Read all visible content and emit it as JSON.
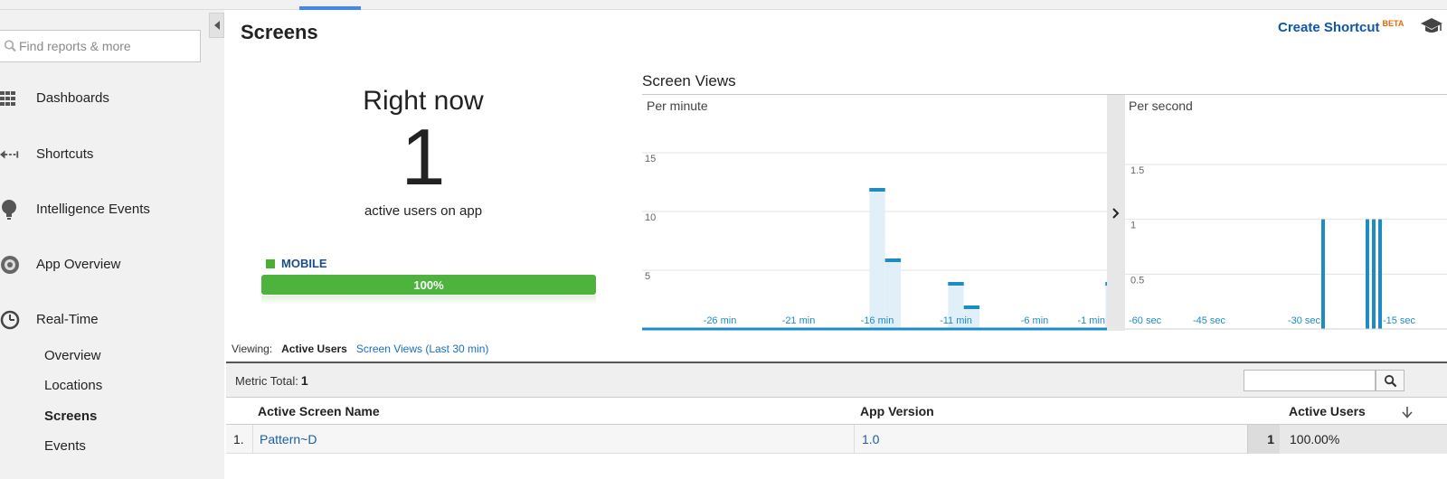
{
  "sidebar": {
    "search_placeholder": "Find reports & more",
    "items": [
      {
        "label": "Dashboards",
        "icon": "grid-icon"
      },
      {
        "label": "Shortcuts",
        "icon": "shortcut-arrow-icon"
      },
      {
        "label": "Intelligence Events",
        "icon": "lightbulb-icon"
      },
      {
        "label": "App Overview",
        "icon": "circle-icon"
      },
      {
        "label": "Real-Time",
        "icon": "clock-icon"
      }
    ],
    "subitems": [
      {
        "label": "Overview",
        "active": false
      },
      {
        "label": "Locations",
        "active": false
      },
      {
        "label": "Screens",
        "active": true
      },
      {
        "label": "Events",
        "active": false
      }
    ]
  },
  "header": {
    "title": "Screens",
    "shortcut_label": "Create Shortcut",
    "shortcut_badge": "BETA"
  },
  "rightnow": {
    "title": "Right now",
    "count": "1",
    "subtitle": "active users on app",
    "segment_label": "MOBILE",
    "segment_percent": "100%",
    "segment_fraction": 1.0,
    "segment_color": "#4db33d"
  },
  "screen_views": {
    "title": "Screen Views"
  },
  "chart_data": [
    {
      "type": "bar",
      "title": "Per minute",
      "x_tick_labels": [
        "-26 min",
        "-21 min",
        "-16 min",
        "-11 min",
        "-6 min",
        "-1 min"
      ],
      "y_ticks": [
        "15",
        "10",
        "5"
      ],
      "ylim": [
        0,
        15
      ],
      "x_minutes_ago": [
        -16,
        -15,
        -11,
        -10,
        -1
      ],
      "values": [
        12,
        6,
        4,
        2,
        4
      ],
      "color": "#1e8bc3"
    },
    {
      "type": "bar",
      "title": "Per second",
      "x_tick_labels": [
        "-60 sec",
        "-45 sec",
        "-30 sec",
        "-15 sec"
      ],
      "y_ticks": [
        "1.5",
        "1",
        "0.5"
      ],
      "ylim": [
        0,
        1.5
      ],
      "x_seconds_ago": [
        -27,
        -20,
        -19,
        -18
      ],
      "values": [
        1,
        1,
        1,
        1
      ],
      "color": "#1e8bc3"
    }
  ],
  "viewing": {
    "label": "Viewing:",
    "active_option": "Active Users",
    "other_option": "Screen Views (Last 30 min)"
  },
  "table": {
    "metric_total_label": "Metric Total:",
    "metric_total_value": "1",
    "columns": [
      "Active Screen Name",
      "App Version",
      "Active Users"
    ],
    "rows": [
      {
        "index": "1.",
        "name": "Pattern~D",
        "version": "1.0",
        "count": "1",
        "percent": "100.00%"
      }
    ]
  }
}
